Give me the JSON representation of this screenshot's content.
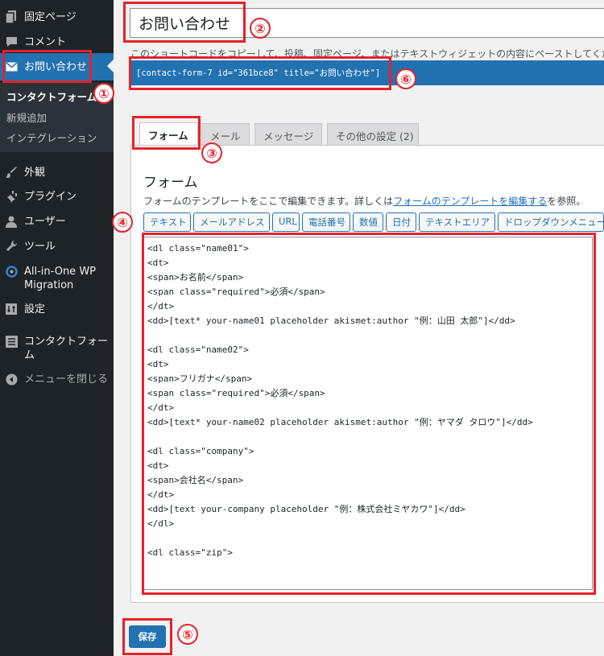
{
  "sidebar": {
    "items": [
      {
        "label": "固定ページ",
        "icon": "page-icon"
      },
      {
        "label": "コメント",
        "icon": "comment-icon"
      },
      {
        "label": "お問い合わせ",
        "icon": "mail-icon"
      },
      {
        "label": "外観",
        "icon": "brush-icon"
      },
      {
        "label": "プラグイン",
        "icon": "plugin-icon"
      },
      {
        "label": "ユーザー",
        "icon": "user-icon"
      },
      {
        "label": "ツール",
        "icon": "wrench-icon"
      },
      {
        "label": "All-in-One WP Migration",
        "icon": "migration-icon"
      },
      {
        "label": "設定",
        "icon": "settings-icon"
      },
      {
        "label": "コンタクトフォーム",
        "icon": "list-icon"
      },
      {
        "label": "メニューを閉じる",
        "icon": "collapse-icon"
      }
    ],
    "submenu": [
      "コンタクトフォーム",
      "新規追加",
      "インテグレーション"
    ]
  },
  "title_value": "お問い合わせ",
  "hint_text": "このショートコードをコピーして、投稿、固定ページ、またはテキストウィジェットの内容にペーストしてください",
  "shortcode": "[contact-form-7 id=\"361bce8\" title=\"お問い合わせ\"]",
  "tabs": [
    "フォーム",
    "メール",
    "メッセージ",
    "その他の設定 (2)"
  ],
  "panel": {
    "heading": "フォーム",
    "desc_before": "フォームのテンプレートをここで編集できます。詳しくは",
    "desc_link": "フォームのテンプレートを編集する",
    "desc_after": "を参照。"
  },
  "tag_buttons": [
    "テキスト",
    "メールアドレス",
    "URL",
    "電話番号",
    "数値",
    "日付",
    "テキストエリア",
    "ドロップダウンメニュー"
  ],
  "code_lines": [
    "<dl class=\"name01\">",
    "<dt>",
    "<span>お名前</span>",
    "<span class=\"required\">必須</span>",
    "</dt>",
    "<dd>[text* your-name01 placeholder akismet:author \"例：山田 太郎\"]</dd>",
    "",
    "<dl class=\"name02\">",
    "<dt>",
    "<span>フリガナ</span>",
    "<span class=\"required\">必須</span>",
    "</dt>",
    "<dd>[text* your-name02 placeholder akismet:author \"例：ヤマダ タロウ\"]</dd>",
    "",
    "<dl class=\"company\">",
    "<dt>",
    "<span>会社名</span>",
    "</dt>",
    "<dd>[text your-company placeholder \"例：株式会社ミヤカワ\"]</dd>",
    "</dl>",
    "",
    "<dl class=\"zip\">"
  ],
  "save_label": "保存",
  "annotations": [
    "①",
    "②",
    "③",
    "④",
    "⑤",
    "⑥"
  ]
}
